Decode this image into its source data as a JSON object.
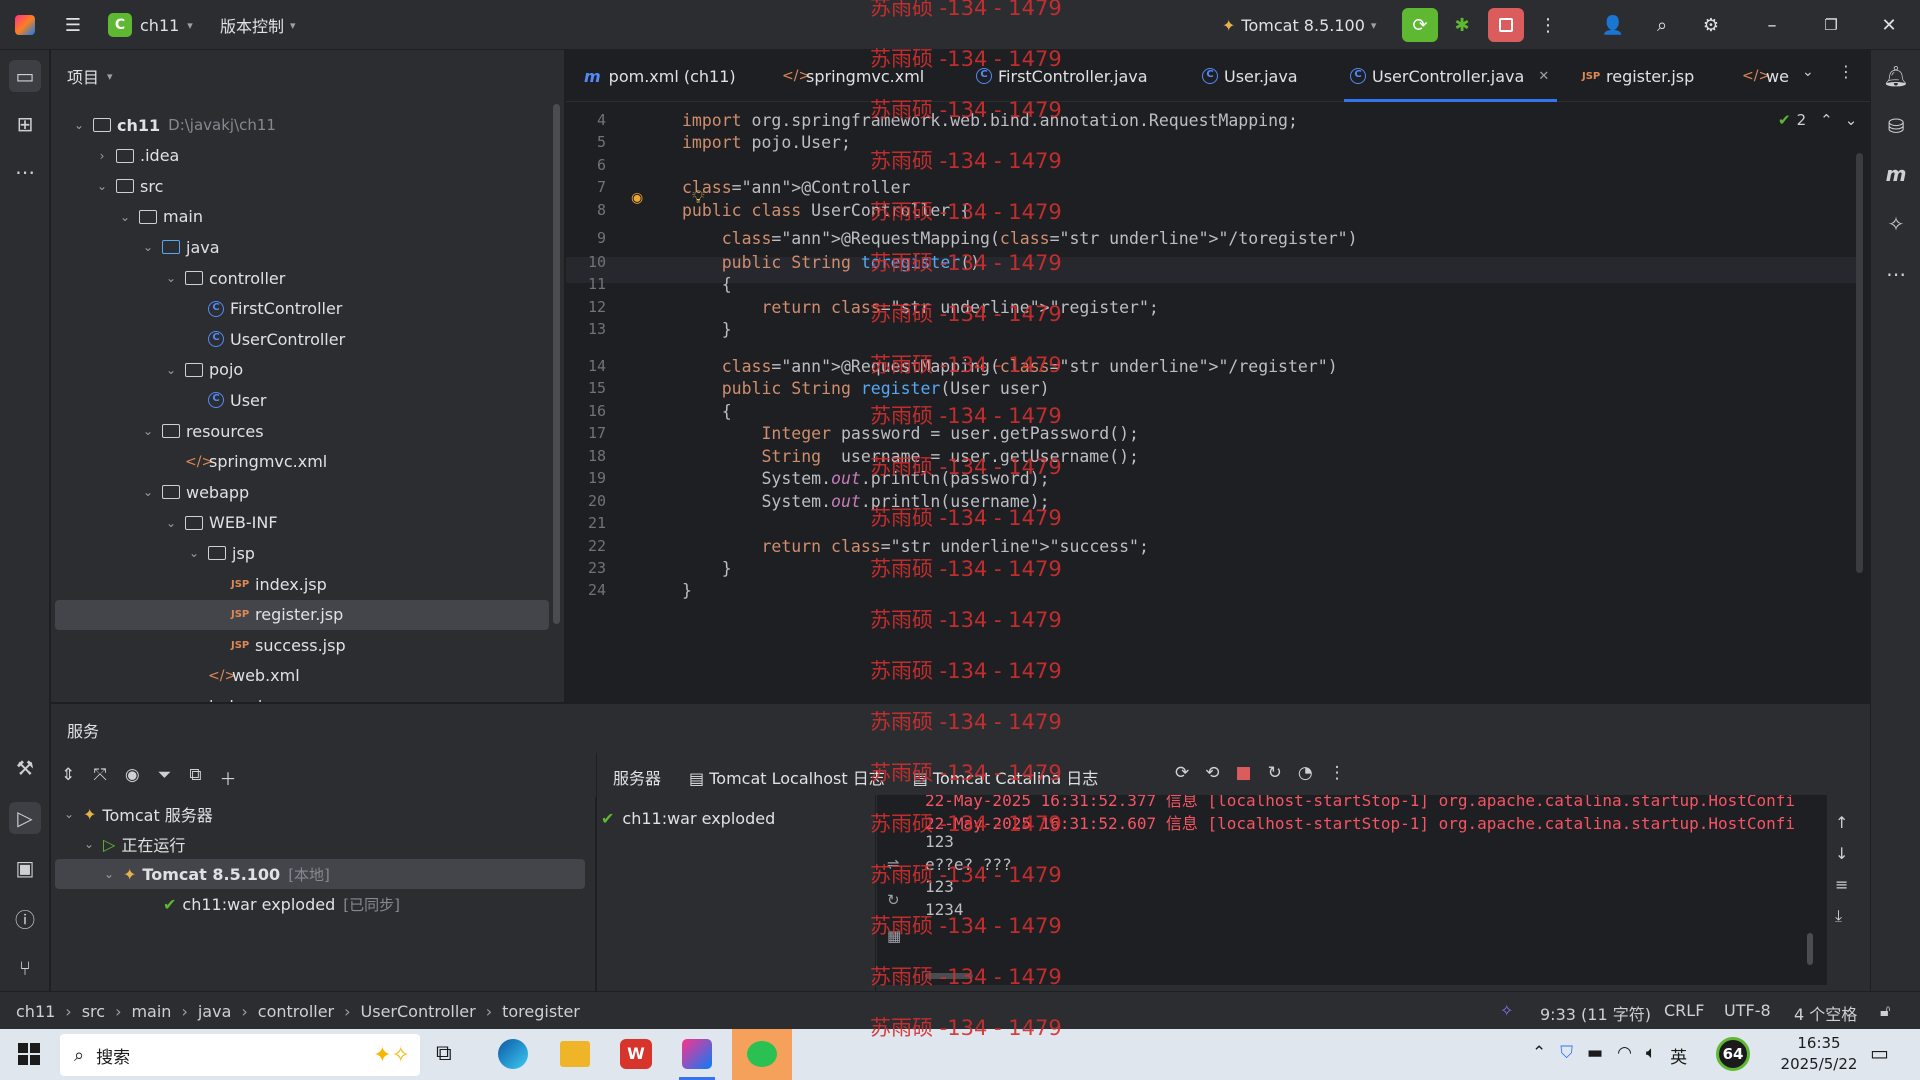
{
  "titlebar": {
    "project_badge": "C",
    "project_name": "ch11",
    "vcs_label": "版本控制",
    "run_config": "Tomcat 8.5.100"
  },
  "project_panel": {
    "title": "项目",
    "tree": [
      {
        "label": "ch11",
        "extra": "D:\\javakj\\ch11",
        "type": "module",
        "level": 0,
        "open": true
      },
      {
        "label": ".idea",
        "type": "folder",
        "level": 1,
        "open": false
      },
      {
        "label": "src",
        "type": "folder",
        "level": 1,
        "open": true
      },
      {
        "label": "main",
        "type": "folder",
        "level": 2,
        "open": true
      },
      {
        "label": "java",
        "type": "folder-blue",
        "level": 3,
        "open": true
      },
      {
        "label": "controller",
        "type": "package",
        "level": 4,
        "open": true
      },
      {
        "label": "FirstController",
        "type": "class",
        "level": 5
      },
      {
        "label": "UserController",
        "type": "class",
        "level": 5
      },
      {
        "label": "pojo",
        "type": "package",
        "level": 4,
        "open": true
      },
      {
        "label": "User",
        "type": "class",
        "level": 5
      },
      {
        "label": "resources",
        "type": "folder",
        "level": 3,
        "open": true
      },
      {
        "label": "springmvc.xml",
        "type": "xml",
        "level": 4
      },
      {
        "label": "webapp",
        "type": "folder",
        "level": 3,
        "open": true
      },
      {
        "label": "WEB-INF",
        "type": "folder",
        "level": 4,
        "open": true
      },
      {
        "label": "jsp",
        "type": "folder",
        "level": 5,
        "open": true
      },
      {
        "label": "index.jsp",
        "type": "jsp",
        "level": 6
      },
      {
        "label": "register.jsp",
        "type": "jsp",
        "level": 6,
        "selected": true
      },
      {
        "label": "success.jsp",
        "type": "jsp",
        "level": 6
      },
      {
        "label": "web.xml",
        "type": "xml",
        "level": 5
      },
      {
        "label": "index.jsp",
        "type": "jsp",
        "level": 4
      }
    ]
  },
  "editor_tabs": [
    {
      "label": "pom.xml (ch11)",
      "icon": "m"
    },
    {
      "label": "springmvc.xml",
      "icon": "xml"
    },
    {
      "label": "FirstController.java",
      "icon": "class"
    },
    {
      "label": "User.java",
      "icon": "class"
    },
    {
      "label": "UserController.java",
      "icon": "class",
      "active": true
    },
    {
      "label": "register.jsp",
      "icon": "jsp"
    },
    {
      "label": "we",
      "icon": "xml"
    }
  ],
  "editor": {
    "inspection_count": "2",
    "lines": [
      {
        "n": "4",
        "code": "import org.springframework.web.bind.annotation.RequestMapping;"
      },
      {
        "n": "5",
        "code": "import pojo.User;"
      },
      {
        "n": "6",
        "code": ""
      },
      {
        "n": "7",
        "code": "@Controller"
      },
      {
        "n": "8",
        "code": "public class UserController {"
      },
      {
        "n": "9",
        "code": "    @RequestMapping(\"/toregister\")"
      },
      {
        "n": "10",
        "code": "    public String toregister()"
      },
      {
        "n": "11",
        "code": "    {"
      },
      {
        "n": "12",
        "code": "        return \"register\";"
      },
      {
        "n": "13",
        "code": "    }"
      },
      {
        "n": "14",
        "code": "    @RequestMapping(\"/register\")"
      },
      {
        "n": "15",
        "code": "    public String register(User user)"
      },
      {
        "n": "16",
        "code": "    {"
      },
      {
        "n": "17",
        "code": "        Integer password = user.getPassword();"
      },
      {
        "n": "18",
        "code": "        String  username = user.getUsername();"
      },
      {
        "n": "19",
        "code": "        System.out.println(password);"
      },
      {
        "n": "20",
        "code": "        System.out.println(username);"
      },
      {
        "n": "21",
        "code": ""
      },
      {
        "n": "22",
        "code": "        return \"success\";"
      },
      {
        "n": "23",
        "code": "    }"
      },
      {
        "n": "24",
        "code": "}"
      }
    ]
  },
  "services": {
    "title": "服务",
    "tree": [
      {
        "label": "Tomcat 服务器"
      },
      {
        "label": "正在运行"
      },
      {
        "label": "Tomcat 8.5.100",
        "extra": "[本地]"
      },
      {
        "label": "ch11:war exploded",
        "extra": "[已同步]"
      }
    ],
    "tabs": [
      "服务器",
      "Tomcat Localhost 日志",
      "Tomcat Catalina 日志"
    ],
    "deployment": "ch11:war exploded",
    "log_lines": [
      {
        "text": "22-May-2025 16:31:52.377 信息 [localhost-startStop-1] org.apache.catalina.startup.HostConfi",
        "red": true
      },
      {
        "text": "22-May-2025 16:31:52.607 信息 [localhost-startStop-1] org.apache.catalina.startup.HostConfi",
        "red": true
      },
      {
        "text": "123",
        "red": false
      },
      {
        "text": "e??e? ???",
        "red": false
      },
      {
        "text": "123",
        "red": false
      },
      {
        "text": "1234",
        "red": false
      }
    ]
  },
  "statusbar": {
    "breadcrumbs": [
      "ch11",
      "src",
      "main",
      "java",
      "controller",
      "UserController",
      "toregister"
    ],
    "position": "9:33 (11 字符)",
    "line_sep": "CRLF",
    "encoding": "UTF-8",
    "indent": "4 个空格"
  },
  "taskbar": {
    "search": "搜索",
    "ime": "英",
    "battery": "64",
    "time": "16:35",
    "date": "2025/5/22"
  },
  "watermark": "苏雨硕 -134 - 1479"
}
